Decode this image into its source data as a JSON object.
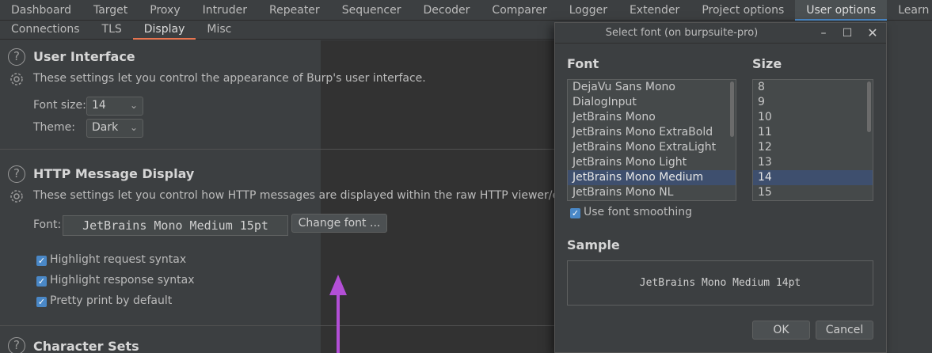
{
  "tabs": [
    "Dashboard",
    "Target",
    "Proxy",
    "Intruder",
    "Repeater",
    "Sequencer",
    "Decoder",
    "Comparer",
    "Logger",
    "Extender",
    "Project options",
    "User options",
    "Learn"
  ],
  "active_tab": "User options",
  "subtabs": [
    "Connections",
    "TLS",
    "Display",
    "Misc"
  ],
  "active_subtab": "Display",
  "ui_section": {
    "title": "User Interface",
    "description": "These settings let you control the appearance of Burp's user interface.",
    "font_size_label": "Font size:",
    "font_size_value": "14",
    "theme_label": "Theme:",
    "theme_value": "Dark"
  },
  "http_section": {
    "title": "HTTP Message Display",
    "description": "These settings let you control how HTTP messages are displayed within the raw HTTP viewer/editor.",
    "font_label": "Font:",
    "font_value": "JetBrains Mono Medium 15pt",
    "change_font_button": "Change font ...",
    "checkboxes": [
      "Highlight request syntax",
      "Highlight response syntax",
      "Pretty print by default"
    ]
  },
  "charset_section": {
    "title": "Character Sets"
  },
  "dialog": {
    "title": "Select font (on burpsuite-pro)",
    "font_label": "Font",
    "size_label": "Size",
    "fonts": [
      "DejaVu Sans Mono",
      "DialogInput",
      "JetBrains Mono",
      "JetBrains Mono ExtraBold",
      "JetBrains Mono ExtraLight",
      "JetBrains Mono Light",
      "JetBrains Mono Medium",
      "JetBrains Mono NL"
    ],
    "selected_font": "JetBrains Mono Medium",
    "sizes": [
      "8",
      "9",
      "10",
      "11",
      "12",
      "13",
      "14",
      "15"
    ],
    "selected_size": "14",
    "smoothing_label": "Use font smoothing",
    "sample_label": "Sample",
    "sample_text": "JetBrains Mono Medium 14pt",
    "ok_button": "OK",
    "cancel_button": "Cancel"
  },
  "colors": {
    "accent": "#4a88c7",
    "subtab_underline": "#e8744f",
    "arrow": "#b34fd6"
  }
}
